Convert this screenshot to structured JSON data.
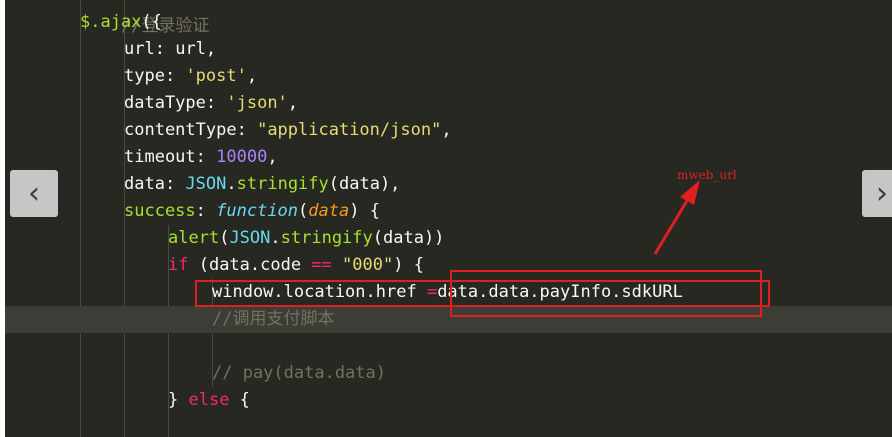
{
  "code_lines": {
    "l0": "//登录验证",
    "l1_call": "$.ajax",
    "l1_open": "({",
    "l2_key": "url",
    "l2_val": "url",
    "l3_key": "type",
    "l3_val": "'post'",
    "l4_key": "dataType",
    "l4_val": "'json'",
    "l5_key": "contentType",
    "l5_val": "\"application/json\"",
    "l6_key": "timeout",
    "l6_val": "10000",
    "l7_key": "data",
    "l7_obj": "JSON",
    "l7_fn": "stringify",
    "l7_arg": "(data),",
    "l8_key": "success",
    "l8_kw": "function",
    "l8_param": "data",
    "l9_fn": "alert",
    "l9_obj": "JSON",
    "l9_fn2": "stringify",
    "l9_arg": "(data))",
    "l10_kw": "if",
    "l10_cond": " (data.code ",
    "l10_op": "==",
    "l10_str": "\"000\"",
    "l10_end": ") {",
    "l11_left": "window.location.href ",
    "l11_op": "=",
    "l11_right": "data.data.payInfo.sdkURL",
    "l12_comment": "//调用支付脚本",
    "l14_comment": "// pay(data.data)",
    "l15_close": "} ",
    "l15_kw": "else",
    "l15_brace": " {"
  },
  "annotation": {
    "label": "mweb_url"
  },
  "nav": {
    "prev_icon": "‹",
    "next_icon": "›"
  },
  "colors": {
    "highlight_box": "#e02020",
    "editor_bg": "#272822"
  }
}
